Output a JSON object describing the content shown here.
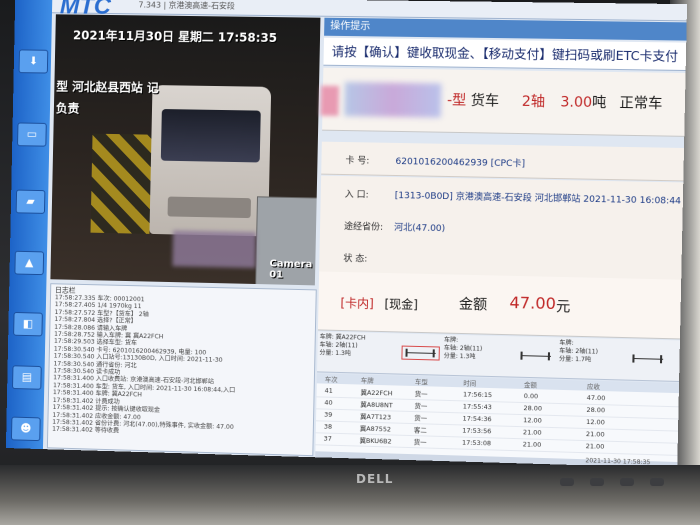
{
  "app": {
    "logo": "MTC",
    "titlebar_text": "7.343 | 京港澳高速-石安段"
  },
  "camera": {
    "timestamp": "2021年11月30日 星期二 17:58:35",
    "location_line1": "型 河北赵县西站 记",
    "location_line2": "负责",
    "label": "Camera 01"
  },
  "log": {
    "title": "日志栏",
    "lines": [
      "17:58:27.335 车次: 00012001",
      "17:58:27.405        1/4       1970kg       11",
      "17:58:27.572 车型?【货车】 2轴",
      "17:58:27.804 选择?【正常】",
      "17:58:28.086 请输入车牌",
      "17:58:28.752 输入车牌: 冀 冀A22FCH",
      "17:58:29.503 选择车型: 货车",
      "17:58:30.540 卡号: 6201016200462939, 电量: 100",
      "17:58:30.540 入口站号:13130B0D, 入口时间: 2021-11-30",
      "17:58:30.540 通行省份: 河北",
      "17:58:30.540 读卡成功",
      "17:58:31.400 入口收费站: 京港澳高速-石安段-河北邯郸站",
      "17:58:31.400 车型: 货车, 入口时间: 2021-11-30 16:08:44,入口",
      "17:58:31.400 车牌: 冀A22FCH",
      "17:58:31.402 计费成功",
      "17:58:31.402 提示: 按确认键收取现金",
      "17:58:31.402 应收金额: 47.00",
      "17:58:31.402 省份计费: 河北(47.00),特殊事件, 实收金额: 47.00",
      "17:58:31.402 等待收费"
    ]
  },
  "operation": {
    "header": "操作提示",
    "prompt": "请按【确认】键收取现金、【移动支付】键扫码或刷ETC卡支付",
    "vehicle_type_suffix": "-型",
    "vehicle_class": "货车",
    "axle_count": "2轴",
    "weight_value": "3.00",
    "weight_unit": "吨",
    "vehicle_status": "正常车",
    "card_label": "卡  号:",
    "card_value": "6201016200462939 [CPC卡]",
    "entry_label": "入  口:",
    "entry_value": "[1313-0B0D] 京港澳高速-石安段 河北邯郸站 2021-11-30 16:08:44",
    "province_label": "途经省份:",
    "province_value": "河北(47.00)",
    "state_label": "状  态:",
    "state_value": "",
    "pay_type": "[卡内]",
    "pay_method": "[现金]",
    "amount_label": "金额",
    "amount_value": "47.00",
    "amount_unit": "元"
  },
  "axles": [
    {
      "line1": "车牌: 冀A22FCH",
      "line2": "车轴: 2轴(11)",
      "line3": "分量: 1.3吨"
    },
    {
      "line1": "车牌:",
      "line2": "车轴: 2轴(11)",
      "line3": "分量: 1.3吨"
    },
    {
      "line1": "车牌:",
      "line2": "车轴: 2轴(11)",
      "line3": "分量: 1.7吨"
    },
    {
      "line1": "车牌:",
      "line2": "车轴:",
      "line3": "分量:"
    }
  ],
  "table": {
    "headers": [
      "车次",
      "车牌",
      "车型",
      "时间",
      "金额",
      "应收"
    ],
    "rows": [
      [
        "41",
        "冀A22FCH",
        "货一",
        "17:56:15",
        "0.00",
        "47.00"
      ],
      [
        "40",
        "冀A8U8NT",
        "货一",
        "17:55:43",
        "28.00",
        "28.00"
      ],
      [
        "39",
        "冀A7T123",
        "货一",
        "17:54:36",
        "12.00",
        "12.00"
      ],
      [
        "38",
        "冀A87552",
        "客二",
        "17:53:56",
        "21.00",
        "21.00"
      ],
      [
        "37",
        "冀BKU6B2",
        "货一",
        "17:53:08",
        "21.00",
        "21.00"
      ]
    ]
  },
  "footer_time": "2021-11-30 17:58:35",
  "monitor_brand": "DELL"
}
